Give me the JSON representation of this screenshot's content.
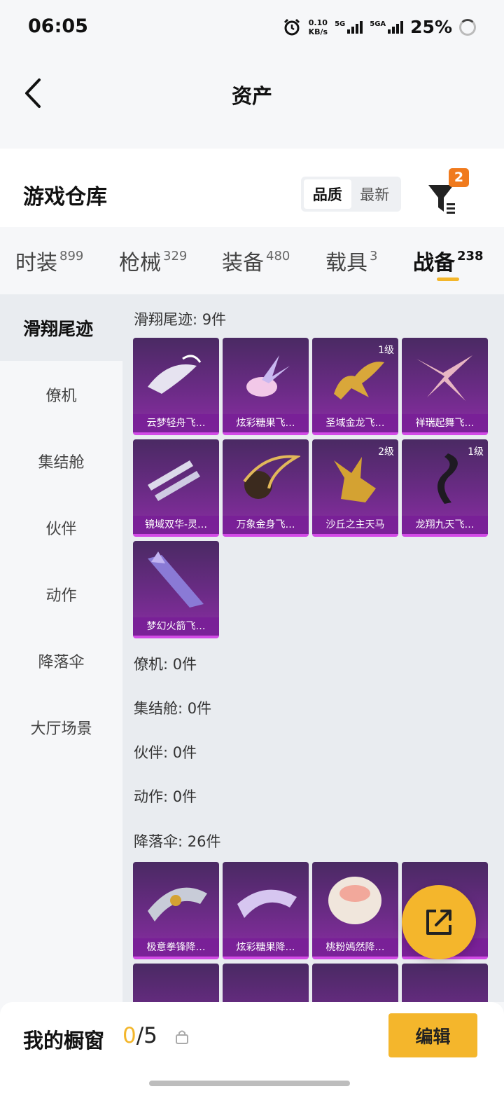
{
  "status": {
    "time": "06:05",
    "net_speed": "0.10",
    "net_unit": "KB/s",
    "sig1": "5G",
    "sig2": "5GA",
    "battery": "25%"
  },
  "header": {
    "title": "资产"
  },
  "warehouse": {
    "label": "游戏仓库",
    "sort_options": [
      "品质",
      "最新"
    ],
    "sort_selected": "品质",
    "filter_badge": "2"
  },
  "tabs": [
    {
      "label": "时装",
      "count": "899"
    },
    {
      "label": "枪械",
      "count": "329"
    },
    {
      "label": "装备",
      "count": "480"
    },
    {
      "label": "载具",
      "count": "3"
    },
    {
      "label": "战备",
      "count": "238",
      "active": true
    }
  ],
  "sidebar": [
    "滑翔尾迹",
    "僚机",
    "集结舱",
    "伙伴",
    "动作",
    "降落伞",
    "大厅场景"
  ],
  "sections": [
    {
      "title": "滑翔尾迹: 9件",
      "items": [
        {
          "name": "云梦轻舟飞…",
          "level": ""
        },
        {
          "name": "炫彩糖果飞…",
          "level": ""
        },
        {
          "name": "圣域金龙飞…",
          "level": "1级"
        },
        {
          "name": "祥瑞起舞飞…",
          "level": ""
        },
        {
          "name": "镜域双华-灵…",
          "level": ""
        },
        {
          "name": "万象金身飞…",
          "level": ""
        },
        {
          "name": "沙丘之主天马",
          "level": "2级"
        },
        {
          "name": "龙翔九天飞…",
          "level": "1级"
        },
        {
          "name": "梦幻火箭飞…",
          "level": ""
        }
      ]
    },
    {
      "title": "僚机: 0件"
    },
    {
      "title": "集结舱: 0件"
    },
    {
      "title": "伙伴: 0件"
    },
    {
      "title": "动作: 0件"
    },
    {
      "title": "降落伞: 26件",
      "items": [
        {
          "name": "极意拳锋降…",
          "level": ""
        },
        {
          "name": "炫彩糖果降…",
          "level": ""
        },
        {
          "name": "桃粉嫣然降…",
          "level": ""
        },
        {
          "name": "",
          "level": ""
        }
      ]
    }
  ],
  "showcase": {
    "label": "我的橱窗",
    "current": "0",
    "total": "/5",
    "edit_label": "编辑"
  },
  "icons": [
    "back-arrow-icon",
    "filter-icon",
    "share-icon",
    "lock-icon",
    "alarm-icon"
  ],
  "colors": {
    "accent": "#f4b62c",
    "badge": "#f07a1d",
    "card_bg": "#6b2b86"
  }
}
